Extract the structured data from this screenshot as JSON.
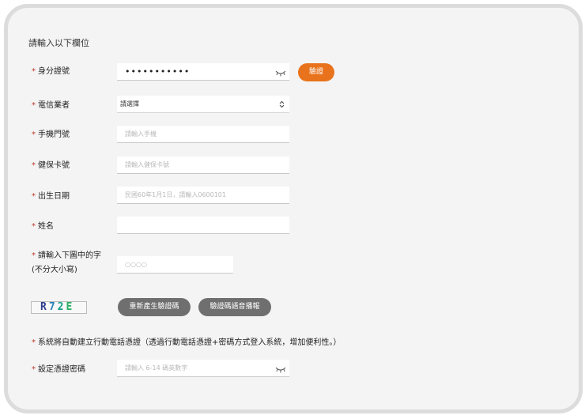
{
  "form": {
    "heading": "請輸入以下欄位",
    "star": "*",
    "id_number": {
      "label": "身分證號",
      "value": "•••••••••••",
      "verify_label": "驗證"
    },
    "carrier": {
      "label": "電信業者",
      "selected": "請選擇",
      "arrow": "⌃⌄"
    },
    "phone": {
      "label": "手機門號",
      "placeholder": "請輸入手機"
    },
    "health_card": {
      "label": "健保卡號",
      "placeholder": "請輸入健保卡號"
    },
    "birthdate": {
      "label": "出生日期",
      "placeholder": "民國60年1月1日，請輸入0600101"
    },
    "name": {
      "label": "姓名",
      "placeholder": ""
    },
    "captcha": {
      "label_line1": "請輸入下圖中的字",
      "label_line2": "(不分大小寫)",
      "placeholder": "○○○○",
      "code": [
        "R",
        "7",
        "2",
        "E"
      ],
      "colors": [
        "#2c3e8f",
        "#2980b9",
        "#16a085",
        "#27ae60"
      ],
      "regen_label": "重新產生驗證碼",
      "voice_label": "驗證碼語音播報"
    },
    "note": "系統將自動建立行動電話憑證（透過行動電話憑證+密碼方式登入系統，增加便利性。）",
    "password": {
      "label": "設定憑證密碼",
      "placeholder": "請輸入 6-14 碼英數字"
    }
  },
  "colors": {
    "accent": "#e8731c",
    "secondary_button": "#6f6f6f",
    "required": "#c0392b"
  }
}
